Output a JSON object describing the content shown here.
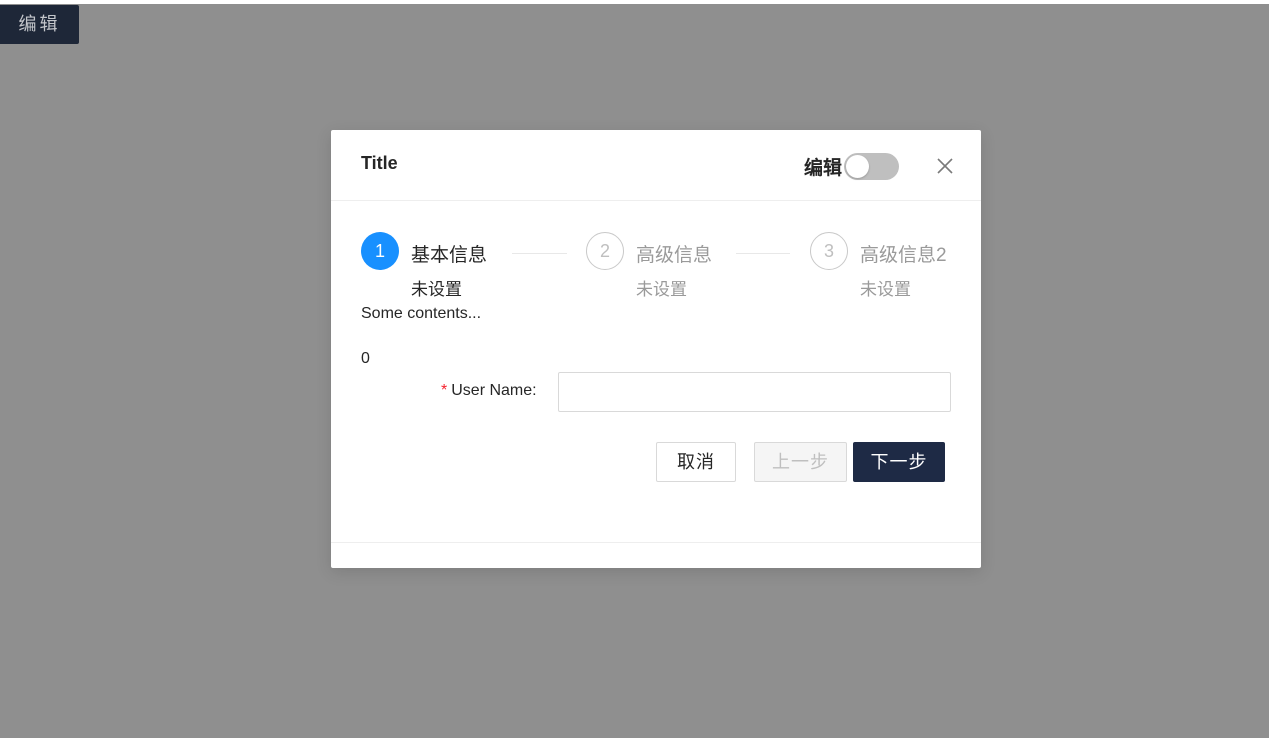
{
  "page": {
    "edit_button_label": "编辑"
  },
  "modal": {
    "title": "Title",
    "edit_toggle_label": "编辑",
    "edit_toggle_on": false,
    "close_icon": "close-icon",
    "steps": [
      {
        "number": "1",
        "title": "基本信息",
        "description": "未设置",
        "status": "active"
      },
      {
        "number": "2",
        "title": "高级信息",
        "description": "未设置",
        "status": "wait"
      },
      {
        "number": "3",
        "title": "高级信息2",
        "description": "未设置",
        "status": "wait"
      }
    ],
    "content_text": "Some contents...",
    "counter_value": "0",
    "form": {
      "username_label": "User Name",
      "username_required_mark": "*",
      "username_colon": ":",
      "username_value": "",
      "username_placeholder": ""
    },
    "buttons": {
      "cancel": "取消",
      "prev": "上一步",
      "next": "下一步"
    }
  },
  "colors": {
    "primary": "#1890ff",
    "dark_button": "#1e2a45",
    "overlay": "#8f8f8f",
    "required": "#f5222d"
  }
}
